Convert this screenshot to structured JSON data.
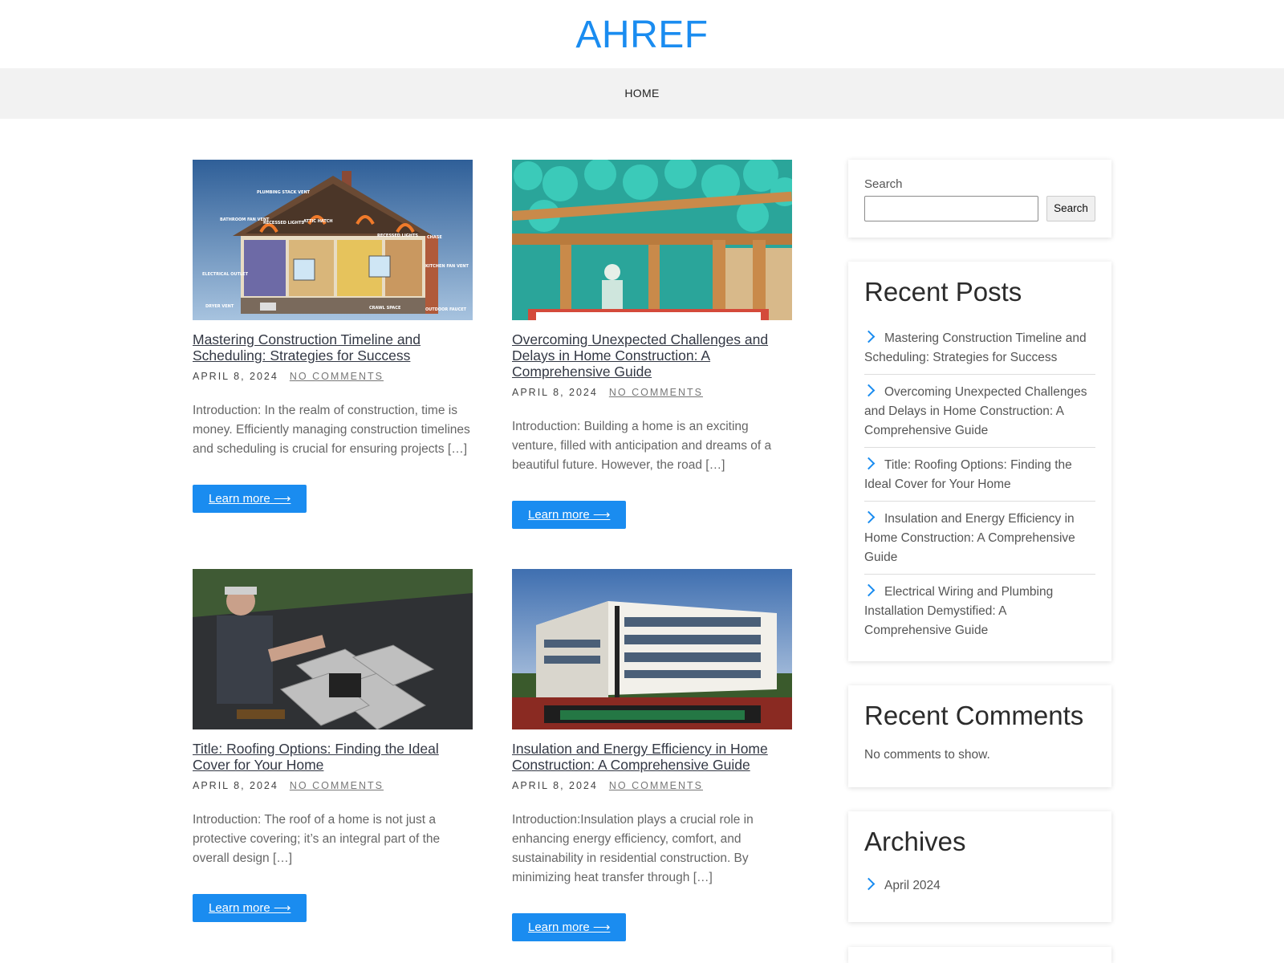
{
  "site": {
    "title": "AHREF"
  },
  "nav": {
    "items": [
      "HOME"
    ]
  },
  "posts": [
    {
      "title": "Mastering Construction Timeline and Scheduling: Strategies for Success",
      "date": "APRIL 8, 2024",
      "comments": "NO COMMENTS",
      "excerpt": "Introduction: In the realm of construction, time is money. Efficiently managing construction timelines and scheduling is crucial for ensuring projects […]",
      "button": "Learn more ⟶",
      "image": {
        "labels": [
          "PLUMBING STACK VENT",
          "BATHROOM FAN VENT",
          "RECESSED LIGHTS",
          "ATTIC HATCH",
          "RECESSED LIGHTS",
          "CHASE",
          "ELECTRICAL OUTLET",
          "KITCHEN FAN VENT",
          "DRYER VENT",
          "CRAWL SPACE",
          "OUTDOOR FAUCET"
        ]
      }
    },
    {
      "title": "Overcoming Unexpected Challenges and Delays in Home Construction: A Comprehensive Guide",
      "date": "APRIL 8, 2024",
      "comments": "NO COMMENTS",
      "excerpt": "Introduction: Building a home is an exciting venture, filled with anticipation and dreams of a beautiful future. However, the road […]",
      "button": "Learn more ⟶"
    },
    {
      "title": "Title: Roofing Options: Finding the Ideal Cover for Your Home",
      "date": "APRIL 8, 2024",
      "comments": "NO COMMENTS",
      "excerpt": "Introduction: The roof of a home is not just a protective covering; it’s an integral part of the overall design […]",
      "button": "Learn more ⟶"
    },
    {
      "title": "Insulation and Energy Efficiency in Home Construction: A Comprehensive Guide",
      "date": "APRIL 8, 2024",
      "comments": "NO COMMENTS",
      "excerpt": "Introduction:Insulation plays a crucial role in enhancing energy efficiency, comfort, and sustainability in residential construction. By minimizing heat transfer through […]",
      "button": "Learn more ⟶"
    }
  ],
  "sidebar": {
    "search": {
      "label": "Search",
      "button": "Search",
      "placeholder": ""
    },
    "recent_posts": {
      "title": "Recent Posts",
      "items": [
        "Mastering Construction Timeline and Scheduling: Strategies for Success",
        "Overcoming Unexpected Challenges and Delays in Home Construction: A Comprehensive Guide",
        "Title: Roofing Options: Finding the Ideal Cover for Your Home",
        "Insulation and Energy Efficiency in Home Construction: A Comprehensive Guide",
        "Electrical Wiring and Plumbing Installation Demystified: A Comprehensive Guide"
      ]
    },
    "recent_comments": {
      "title": "Recent Comments",
      "empty": "No comments to show."
    },
    "archives": {
      "title": "Archives",
      "items": [
        "April 2024"
      ]
    }
  },
  "colors": {
    "accent": "#1a8cf0",
    "nav_bg": "#f2f2f2"
  }
}
